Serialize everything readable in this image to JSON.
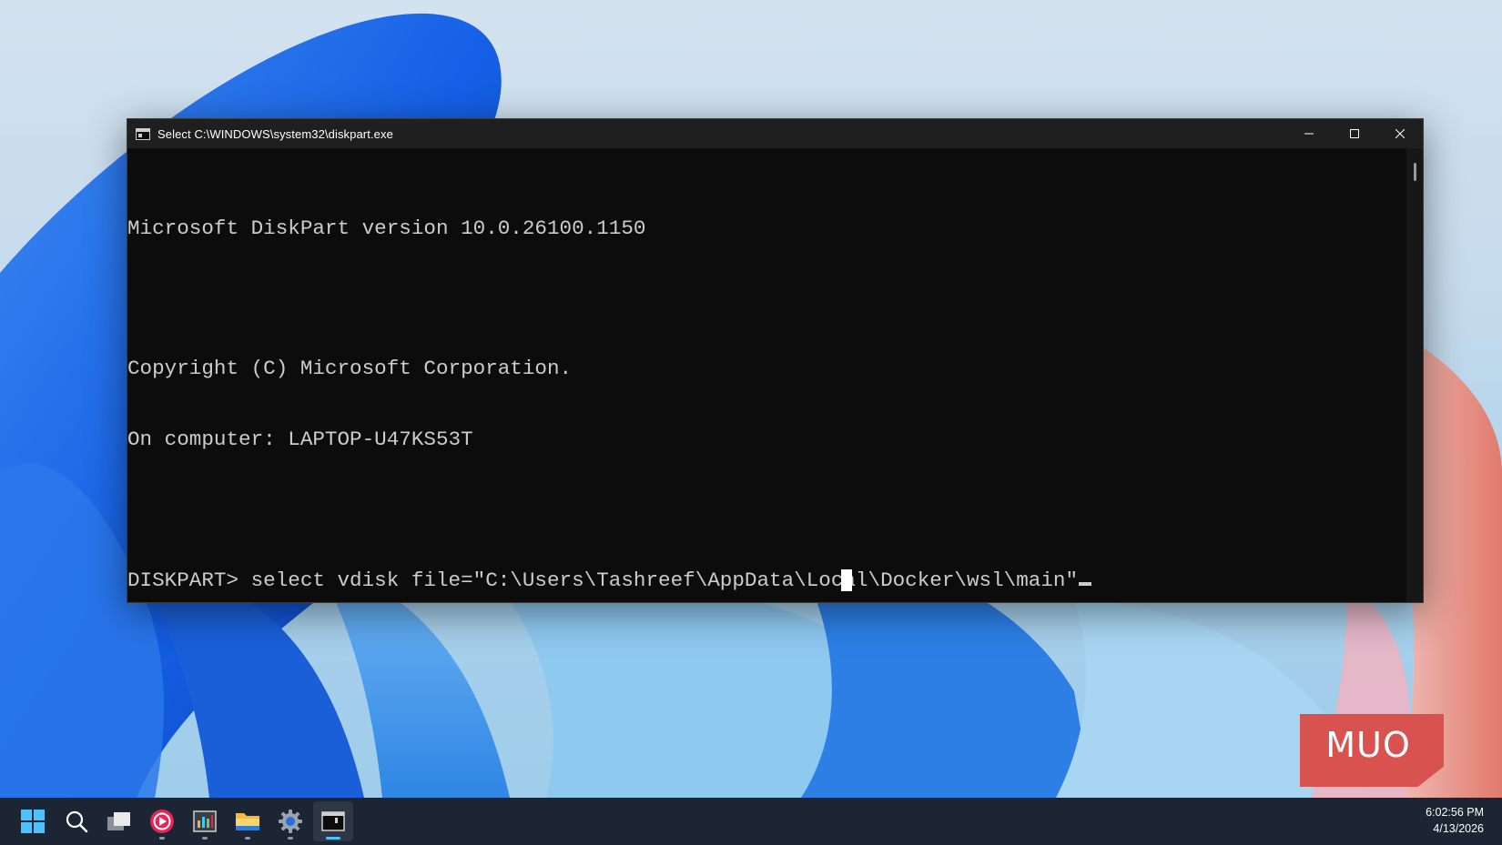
{
  "window": {
    "title": "Select C:\\WINDOWS\\system32\\diskpart.exe",
    "controls": {
      "minimize": "minimize-icon",
      "maximize": "maximize-icon",
      "close": "close-icon"
    }
  },
  "console": {
    "lines": [
      "Microsoft DiskPart version 10.0.26100.1150",
      "",
      "Copyright (C) Microsoft Corporation.",
      "On computer: LAPTOP-U47KS53T",
      "",
      "DISKPART> select vdisk file=\"C:\\Users\\Tashreef\\AppData\\Local\\Docker\\wsl\\main\""
    ]
  },
  "watermark": {
    "text": "MUO"
  },
  "taskbar": {
    "items": [
      {
        "name": "start-icon"
      },
      {
        "name": "search-icon"
      },
      {
        "name": "task-view-icon"
      },
      {
        "name": "media-player-icon"
      },
      {
        "name": "app-icon"
      },
      {
        "name": "file-explorer-icon"
      },
      {
        "name": "settings-icon"
      },
      {
        "name": "terminal-icon"
      }
    ]
  },
  "clock": {
    "time": "6:02:56 PM",
    "date": "4/13/2026"
  },
  "colors": {
    "console_bg": "#0c0c0c",
    "console_text": "#cccccc",
    "taskbar_bg": "#1c2534",
    "accent": "#4cc2ff",
    "watermark": "#d8524f"
  }
}
